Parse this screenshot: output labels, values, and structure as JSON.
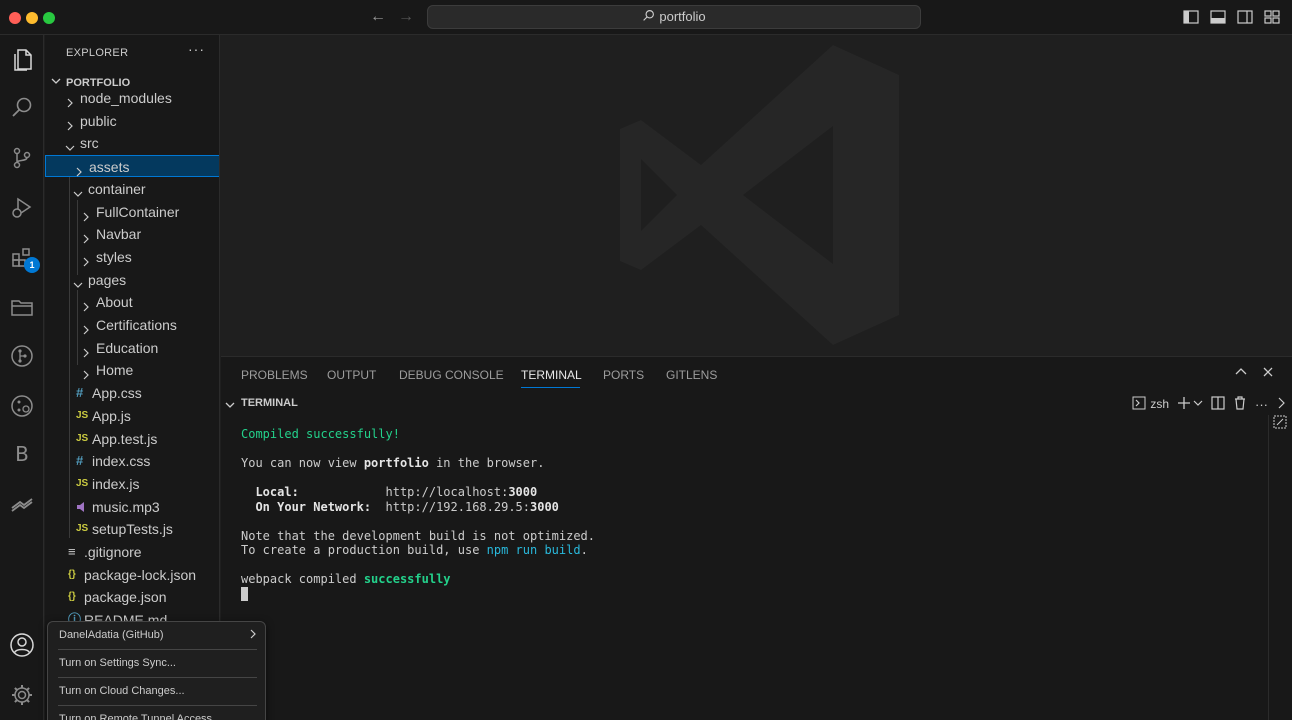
{
  "titlebar": {
    "search_text": "portfolio"
  },
  "activity": {
    "extensions_badge": "1",
    "b_label": "B"
  },
  "explorer": {
    "title": "EXPLORER",
    "more": "···",
    "section": "PORTFOLIO",
    "items": [
      {
        "label": "node_modules",
        "type": "folder"
      },
      {
        "label": "public",
        "type": "folder"
      },
      {
        "label": "src",
        "type": "folder-open"
      },
      {
        "label": "assets",
        "type": "folder"
      },
      {
        "label": "container",
        "type": "folder-open"
      },
      {
        "label": "FullContainer",
        "type": "folder"
      },
      {
        "label": "Navbar",
        "type": "folder"
      },
      {
        "label": "styles",
        "type": "folder"
      },
      {
        "label": "pages",
        "type": "folder-open"
      },
      {
        "label": "About",
        "type": "folder"
      },
      {
        "label": "Certifications",
        "type": "folder"
      },
      {
        "label": "Education",
        "type": "folder"
      },
      {
        "label": "Home",
        "type": "folder"
      },
      {
        "label": "App.css",
        "type": "css",
        "icon": "#"
      },
      {
        "label": "App.js",
        "type": "js",
        "icon": "JS"
      },
      {
        "label": "App.test.js",
        "type": "js",
        "icon": "JS"
      },
      {
        "label": "index.css",
        "type": "css",
        "icon": "#"
      },
      {
        "label": "index.js",
        "type": "js",
        "icon": "JS"
      },
      {
        "label": "music.mp3",
        "type": "audio"
      },
      {
        "label": "setupTests.js",
        "type": "js",
        "icon": "JS"
      },
      {
        "label": ".gitignore",
        "type": "text",
        "icon": "≡"
      },
      {
        "label": "package-lock.json",
        "type": "json",
        "icon": "{}"
      },
      {
        "label": "package.json",
        "type": "json",
        "icon": "{}"
      },
      {
        "label": "README.md",
        "type": "info",
        "icon": "ⓘ"
      }
    ]
  },
  "panel": {
    "tabs": [
      "PROBLEMS",
      "OUTPUT",
      "DEBUG CONSOLE",
      "TERMINAL",
      "PORTS",
      "GITLENS"
    ],
    "active_tab": "TERMINAL",
    "terminal_title": "TERMINAL",
    "shell": "zsh"
  },
  "terminal": {
    "line1": "Compiled successfully!",
    "line2_a": "You can now view ",
    "line2_b": "portfolio",
    "line2_c": " in the browser.",
    "local_label": "  Local:",
    "local_url_a": "http://localhost:",
    "local_url_b": "3000",
    "network_label": "  On Your Network:",
    "network_url_a": "http://192.168.29.5:",
    "network_url_b": "3000",
    "note1": "Note that the development build is not optimized.",
    "note2_a": "To create a production build, use ",
    "note2_b": "npm run build",
    "note2_c": ".",
    "webpack_a": "webpack compiled ",
    "webpack_b": "successfully"
  },
  "accounts_menu": {
    "items": [
      "DanelAdatia (GitHub)",
      "Turn on Settings Sync...",
      "Turn on Cloud Changes...",
      "Turn on Remote Tunnel Access..."
    ]
  },
  "colors": {
    "accent": "#0078d4",
    "terminal_green": "#23d18b",
    "terminal_cyan": "#29b8db",
    "js_icon": "#cbcb41",
    "css_icon": "#519aba",
    "json_icon": "#cbcb41",
    "audio_icon": "#a074c4"
  }
}
